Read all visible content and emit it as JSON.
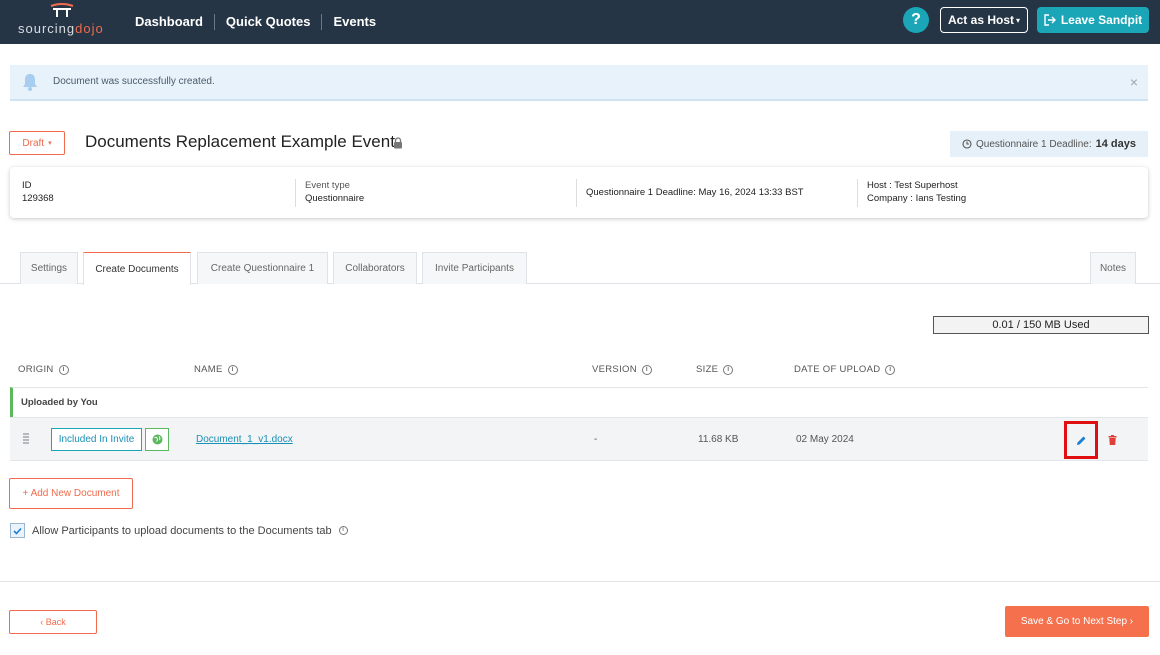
{
  "nav": {
    "logo_text_a": "sourcing",
    "logo_text_b": "dojo",
    "links": [
      "Dashboard",
      "Quick Quotes",
      "Events"
    ],
    "help_label": "?",
    "act_as_host": "Act as Host",
    "leave_sandpit": "Leave Sandpit"
  },
  "alert": {
    "message": "Document was successfully created.",
    "close": "×"
  },
  "header": {
    "status": "Draft",
    "title": "Documents Replacement Example Event",
    "deadline_label": "Questionnaire 1 Deadline:",
    "deadline_value": "14 days"
  },
  "info": {
    "id_label": "ID",
    "id_value": "129368",
    "event_type_label": "Event type",
    "event_type_value": "Questionnaire",
    "deadline": "Questionnaire 1 Deadline: May 16, 2024 13:33 BST",
    "host": "Host : Test Superhost",
    "company": "Company : Ians Testing"
  },
  "tabs": [
    "Settings",
    "Create Documents",
    "Create Questionnaire 1",
    "Collaborators",
    "Invite Participants",
    "Notes"
  ],
  "storage": "0.01 / 150 MB Used",
  "table": {
    "headers": [
      "ORIGIN",
      "NAME",
      "VERSION",
      "SIZE",
      "DATE OF UPLOAD"
    ],
    "info_glyph": "i",
    "group_label": "Uploaded by You",
    "rows": [
      {
        "origin_badge": "Included In Invite",
        "name": "Document_1_v1.docx",
        "version": "-",
        "size": "11.68 KB",
        "date": "02 May 2024"
      }
    ]
  },
  "actions": {
    "add_document": "+ Add New Document",
    "allow_upload": "Allow Participants to upload documents to the Documents tab",
    "back": "‹ Back",
    "save_next": "Save & Go to Next Step ›"
  },
  "colors": {
    "navbar": "#263545",
    "accent_orange": "#ef6b4c",
    "teal": "#1aa6b7",
    "green": "#5cb85c",
    "highlight_red": "#e01010"
  }
}
